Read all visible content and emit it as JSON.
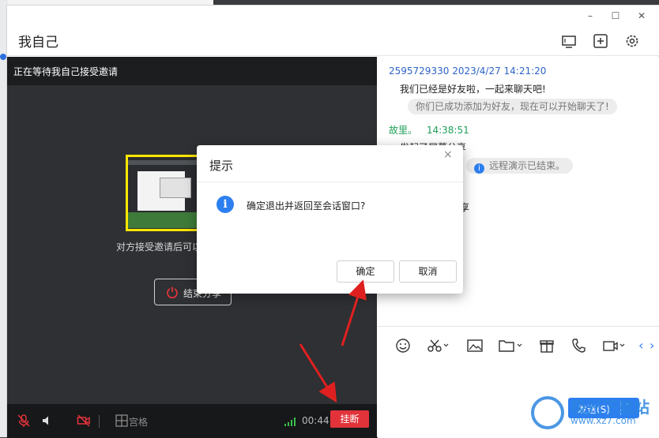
{
  "window": {
    "title": "我自己",
    "controls": {
      "minimize": "–",
      "maximize": "☐",
      "close": "✕"
    },
    "toolbar_icons": [
      "monitor-icon",
      "add-square-icon",
      "settings-icon"
    ]
  },
  "video": {
    "header": "正在等待我自己接受邀请",
    "message": "对方接受邀请后可以",
    "end_share_label": "结束分享",
    "controls": {
      "grid_label": "宫格",
      "timer": "00:44",
      "hangup_label": "挂断"
    }
  },
  "chat": {
    "messages": [
      {
        "sender": "2595729330",
        "time": "2023/4/27 14:21:20",
        "text": "我们已经是好友啦，一起来聊天吧!"
      },
      {
        "system": "你们已成功添加为好友，现在可以开始聊天了!"
      },
      {
        "sender": "故里。",
        "time": "14:38:51",
        "text": "发起了屏幕分享"
      },
      {
        "system": "远程演示已结束。"
      },
      {
        "partial": "享"
      }
    ],
    "send_label": "发送(S)",
    "send_arrow": "˅",
    "tool_icons": [
      "emoji-icon",
      "scissors-icon",
      "image-icon",
      "folder-icon",
      "gift-icon",
      "phone-icon",
      "video-icon"
    ],
    "nav": {
      "prev": "‹",
      "next": "›"
    }
  },
  "dialog": {
    "title": "提示",
    "close": "×",
    "icon": "i",
    "message": "确定退出并返回至会话窗口?",
    "ok_label": "确定",
    "cancel_label": "取消"
  },
  "watermark": {
    "title": "极光下载站",
    "url": "www.xz7.com"
  },
  "colors": {
    "accent": "#2d7ff0",
    "hangup": "#e2333a",
    "sender_blue": "#2d63c8",
    "sender_green": "#1f9e57",
    "video_bg": "#2e3033",
    "annotation_arrow": "#e02020"
  }
}
